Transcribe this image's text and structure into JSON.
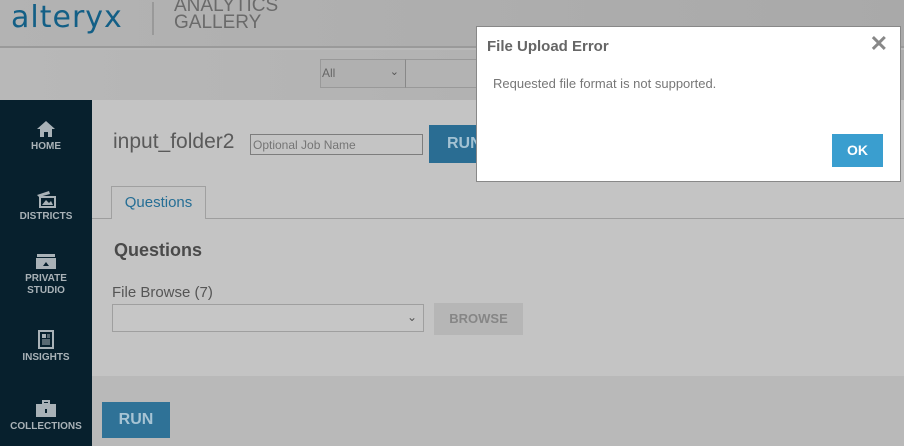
{
  "header": {
    "logo": "alteryx",
    "product_line1": "ANALYTICS",
    "product_line2": "GALLERY"
  },
  "filter": {
    "selected": "All",
    "search_value": ""
  },
  "sidebar": {
    "items": [
      {
        "label": "HOME",
        "icon": "home-icon"
      },
      {
        "label": "DISTRICTS",
        "icon": "districts-icon"
      },
      {
        "label": "PRIVATE",
        "label2": "STUDIO",
        "icon": "studio-icon"
      },
      {
        "label": "INSIGHTS",
        "icon": "insights-icon"
      },
      {
        "label": "COLLECTIONS",
        "icon": "briefcase-icon"
      }
    ]
  },
  "main": {
    "app_title": "input_folder2",
    "job_name_placeholder": "Optional Job Name",
    "run_label": "RUN",
    "tab": "Questions",
    "section_heading": "Questions",
    "file_browse_label": "File Browse (7)",
    "browse_label": "BROWSE",
    "run_bottom_label": "RUN"
  },
  "modal": {
    "title": "File Upload Error",
    "close": "✕",
    "message": "Requested file format is not supported.",
    "ok_label": "OK"
  },
  "colors": {
    "brand": "#135f86",
    "sidebar": "#07202d",
    "ok_button": "#3a9ecf"
  }
}
